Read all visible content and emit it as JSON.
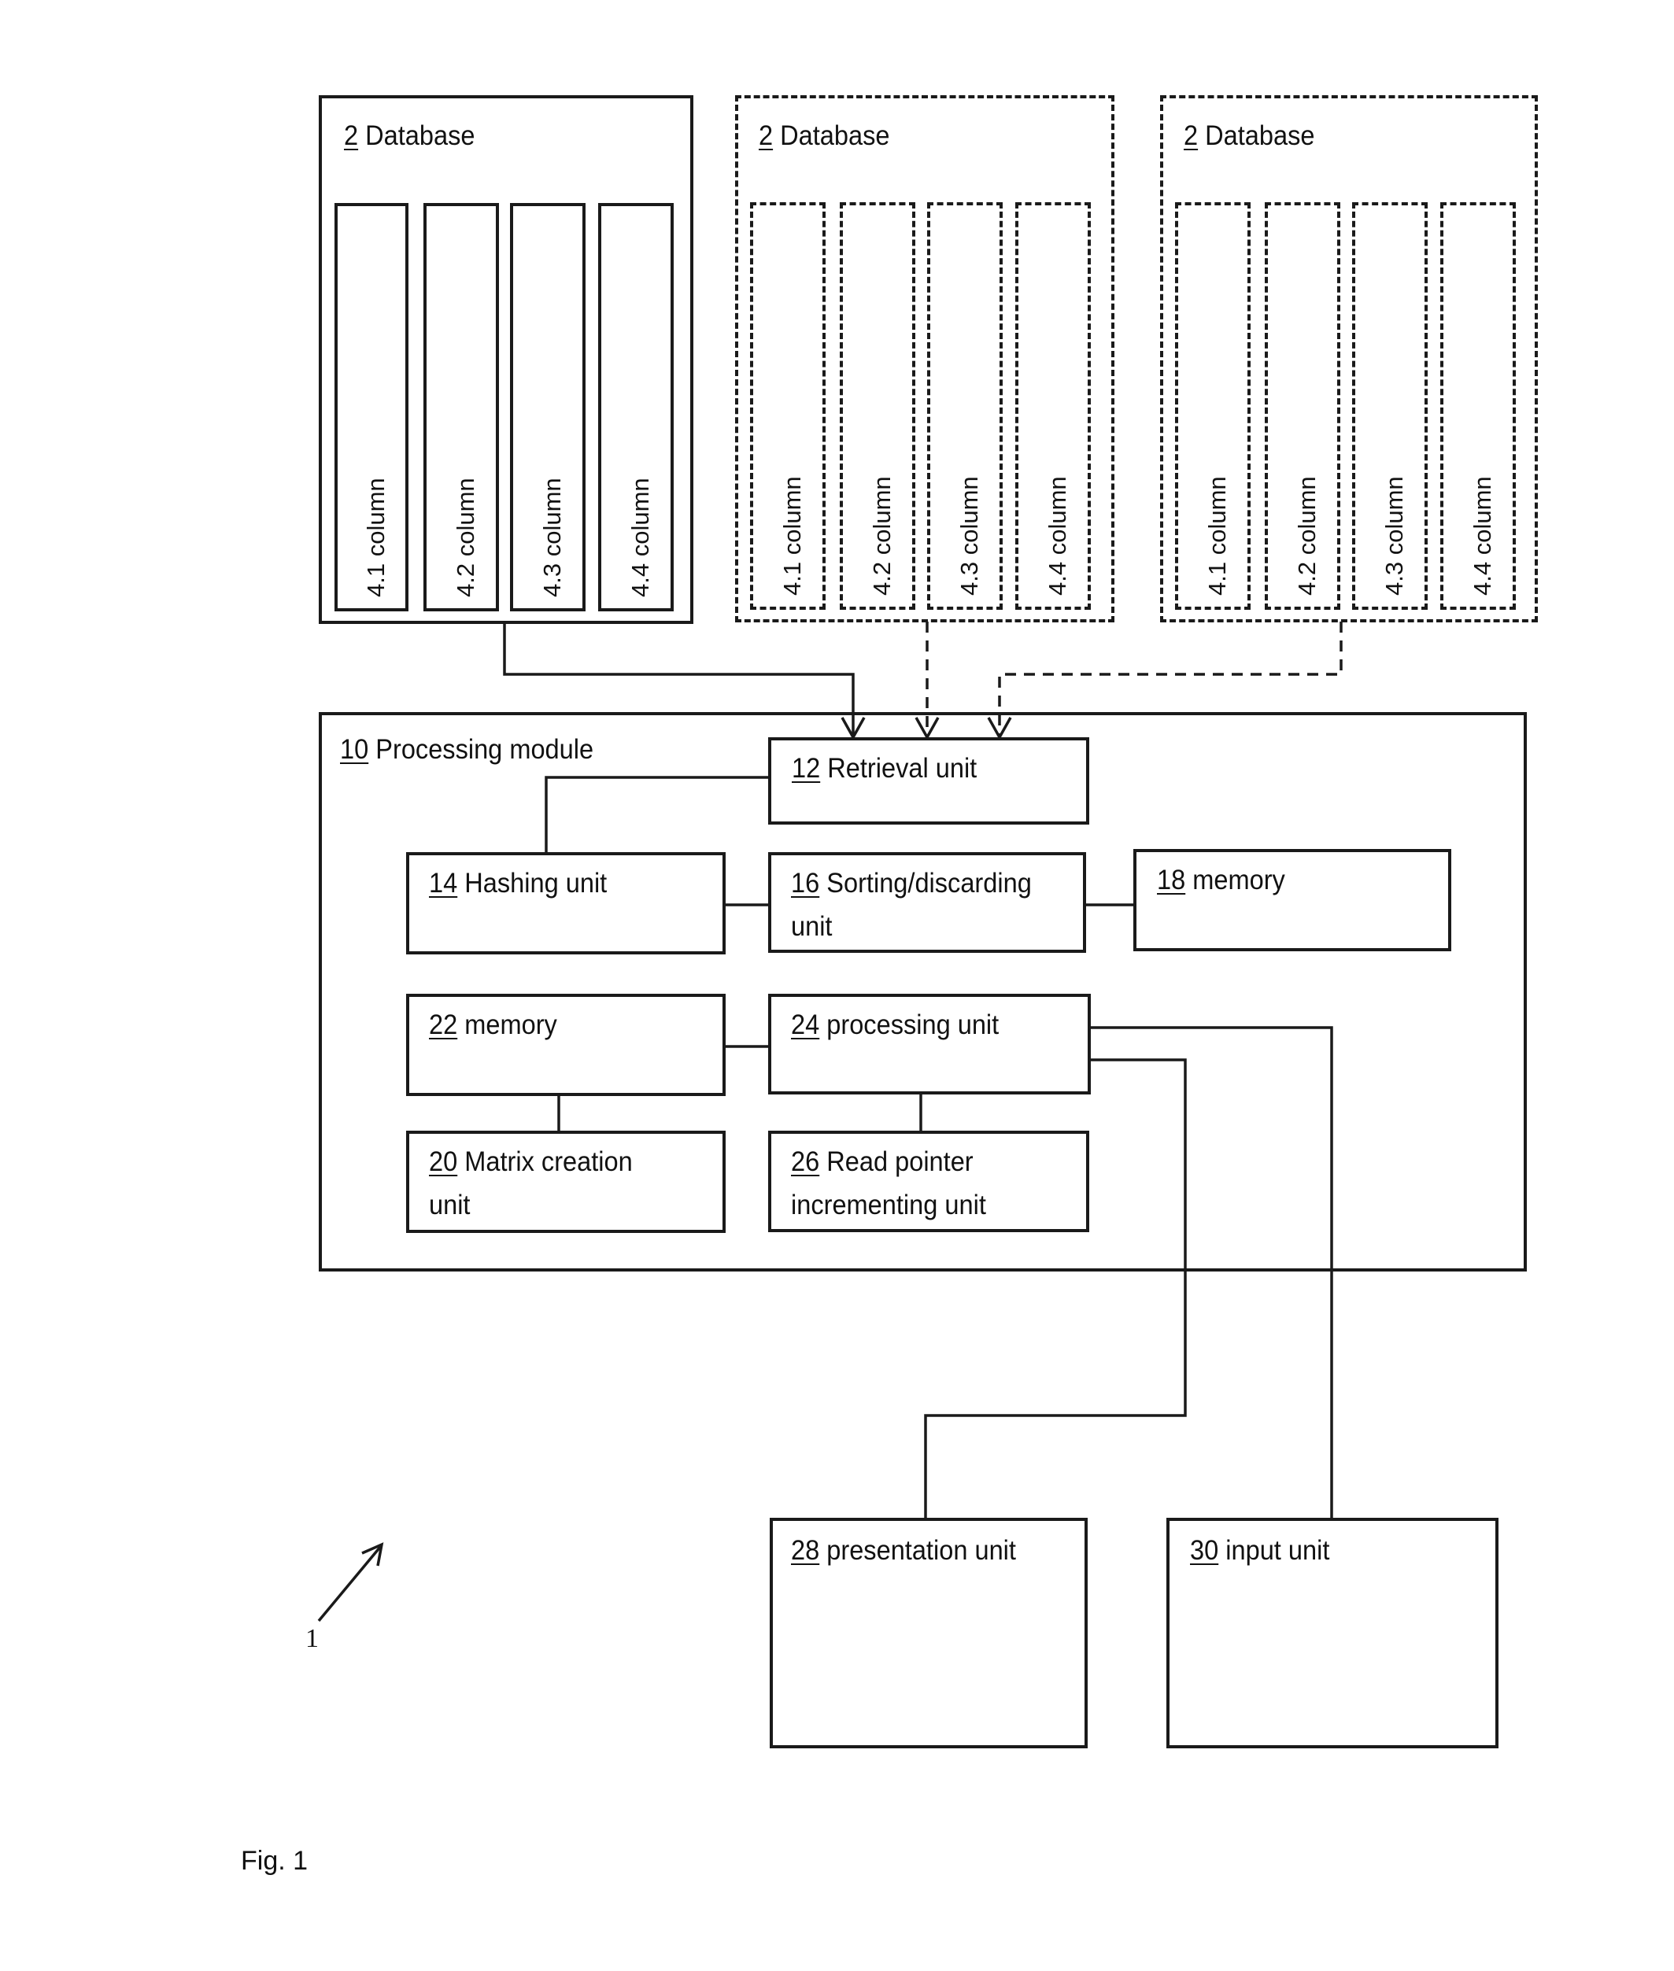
{
  "figure": {
    "caption": "Fig. 1",
    "reference_numeral": "1"
  },
  "databases": [
    {
      "num": "2",
      "title": "Database",
      "style": "solid",
      "columns": [
        {
          "num": "4.1",
          "label": "column"
        },
        {
          "num": "4.2",
          "label": "column"
        },
        {
          "num": "4.3",
          "label": "column"
        },
        {
          "num": "4.4",
          "label": "column"
        }
      ]
    },
    {
      "num": "2",
      "title": "Database",
      "style": "dashed",
      "columns": [
        {
          "num": "4.1",
          "label": "column"
        },
        {
          "num": "4.2",
          "label": "column"
        },
        {
          "num": "4.3",
          "label": "column"
        },
        {
          "num": "4.4",
          "label": "column"
        }
      ]
    },
    {
      "num": "2",
      "title": "Database",
      "style": "dashed",
      "columns": [
        {
          "num": "4.1",
          "label": "column"
        },
        {
          "num": "4.2",
          "label": "column"
        },
        {
          "num": "4.3",
          "label": "column"
        },
        {
          "num": "4.4",
          "label": "column"
        }
      ]
    }
  ],
  "processing_module": {
    "num": "10",
    "title": "Processing module",
    "units": {
      "retrieval": {
        "num": "12",
        "line1": "Retrieval unit",
        "line2": ""
      },
      "hashing": {
        "num": "14",
        "line1": "Hashing unit",
        "line2": ""
      },
      "sorting": {
        "num": "16",
        "line1": "Sorting/discarding",
        "line2": "unit"
      },
      "memory18": {
        "num": "18",
        "line1": "memory",
        "line2": ""
      },
      "memory22": {
        "num": "22",
        "line1": "memory",
        "line2": ""
      },
      "processing": {
        "num": "24",
        "line1": "processing unit",
        "line2": ""
      },
      "matrix": {
        "num": "20",
        "line1": "Matrix creation",
        "line2": "unit"
      },
      "readpointer": {
        "num": "26",
        "line1": "Read pointer",
        "line2": "incrementing unit"
      }
    }
  },
  "external_units": {
    "presentation": {
      "num": "28",
      "line1": "presentation unit"
    },
    "input": {
      "num": "30",
      "line1": "input unit"
    }
  },
  "line_color": "#1a1a1a",
  "connections": [
    {
      "from": "database-1",
      "to": "retrieval-unit",
      "style": "solid",
      "arrow": true
    },
    {
      "from": "database-2",
      "to": "retrieval-unit",
      "style": "dashed",
      "arrow": true
    },
    {
      "from": "database-3",
      "to": "retrieval-unit",
      "style": "dashed",
      "arrow": true
    },
    {
      "from": "retrieval-unit",
      "to": "hashing-unit",
      "style": "solid",
      "arrow": false
    },
    {
      "from": "hashing-unit",
      "to": "sorting-discarding-unit",
      "style": "solid",
      "arrow": false
    },
    {
      "from": "sorting-discarding-unit",
      "to": "memory-18",
      "style": "solid",
      "arrow": false
    },
    {
      "from": "memory-22",
      "to": "processing-unit",
      "style": "solid",
      "arrow": false
    },
    {
      "from": "memory-22",
      "to": "matrix-creation-unit",
      "style": "solid",
      "arrow": false
    },
    {
      "from": "processing-unit",
      "to": "read-pointer-incrementing-unit",
      "style": "solid",
      "arrow": false
    },
    {
      "from": "processing-unit",
      "to": "presentation-unit",
      "style": "solid",
      "arrow": false
    },
    {
      "from": "processing-unit",
      "to": "input-unit",
      "style": "solid",
      "arrow": false
    }
  ]
}
